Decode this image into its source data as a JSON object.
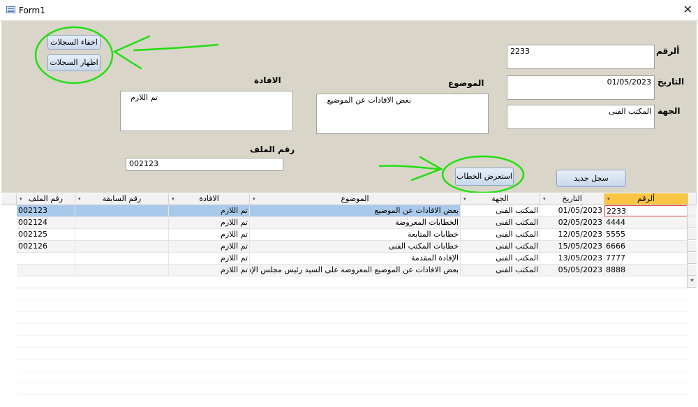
{
  "window": {
    "title": "Form1",
    "close_glyph": "✕",
    "icon": "form-icon"
  },
  "form": {
    "hide_records_label": "اخفاء السجلات",
    "show_records_label": "اظهار السجلات",
    "number_label": "ألرقم",
    "number_value": "2233",
    "date_label": "التاريخ",
    "date_value": "01/05/2023",
    "party_label": "الجهة",
    "party_value": "المكتب الفنى",
    "subject_label": "الموضوع",
    "subject_value": "بعض الافادات عن الموضيع",
    "reply_label": "الافادة",
    "reply_value": "تم اللازم",
    "file_number_label": "رقم الملف",
    "file_number_value": "002123",
    "view_letter_label": "استعرض الخطاب",
    "new_record_label": "سجل جديد",
    "annotation_color": "#22dd11"
  },
  "grid": {
    "columns": [
      "ألرقم",
      "التاريخ",
      "الجهة",
      "الموضوع",
      "الافادة",
      "رقم السابقة",
      "رقم الملف"
    ],
    "dropdown_glyph": "▾",
    "new_row_glyph": "*",
    "rows": [
      {
        "number": "2233",
        "date": "01/05/2023",
        "party": "المكتب الفنى",
        "subject": "بعض الافادات عن الموضيع",
        "reply": "تم اللازم",
        "prev": "",
        "file": "002123"
      },
      {
        "number": "4444",
        "date": "02/05/2023",
        "party": "المكتب الفنى",
        "subject": "الخطابات المعروضة",
        "reply": "تم اللازم",
        "prev": "",
        "file": "002124"
      },
      {
        "number": "5555",
        "date": "12/05/2023",
        "party": "المكتب الفنى",
        "subject": "خطابات المتابعة",
        "reply": "تم اللازم",
        "prev": "",
        "file": "002125"
      },
      {
        "number": "6666",
        "date": "15/05/2023",
        "party": "المكتب الفنى",
        "subject": "خطابات المكتب الفنى",
        "reply": "تم اللازم",
        "prev": "",
        "file": "002126"
      },
      {
        "number": "7777",
        "date": "13/05/2023",
        "party": "المكتب الفنى",
        "subject": "الإفادة المقدمة",
        "reply": "تم اللازم",
        "prev": "",
        "file": ""
      },
      {
        "number": "8888",
        "date": "05/05/2023",
        "party": "المكتب الفنى",
        "subject": "بعض الافادات عن الموضيع المعروضه على السيد رئيس مجلس الإدارة",
        "reply": "تم اللازم",
        "prev": "",
        "file": ""
      }
    ]
  }
}
